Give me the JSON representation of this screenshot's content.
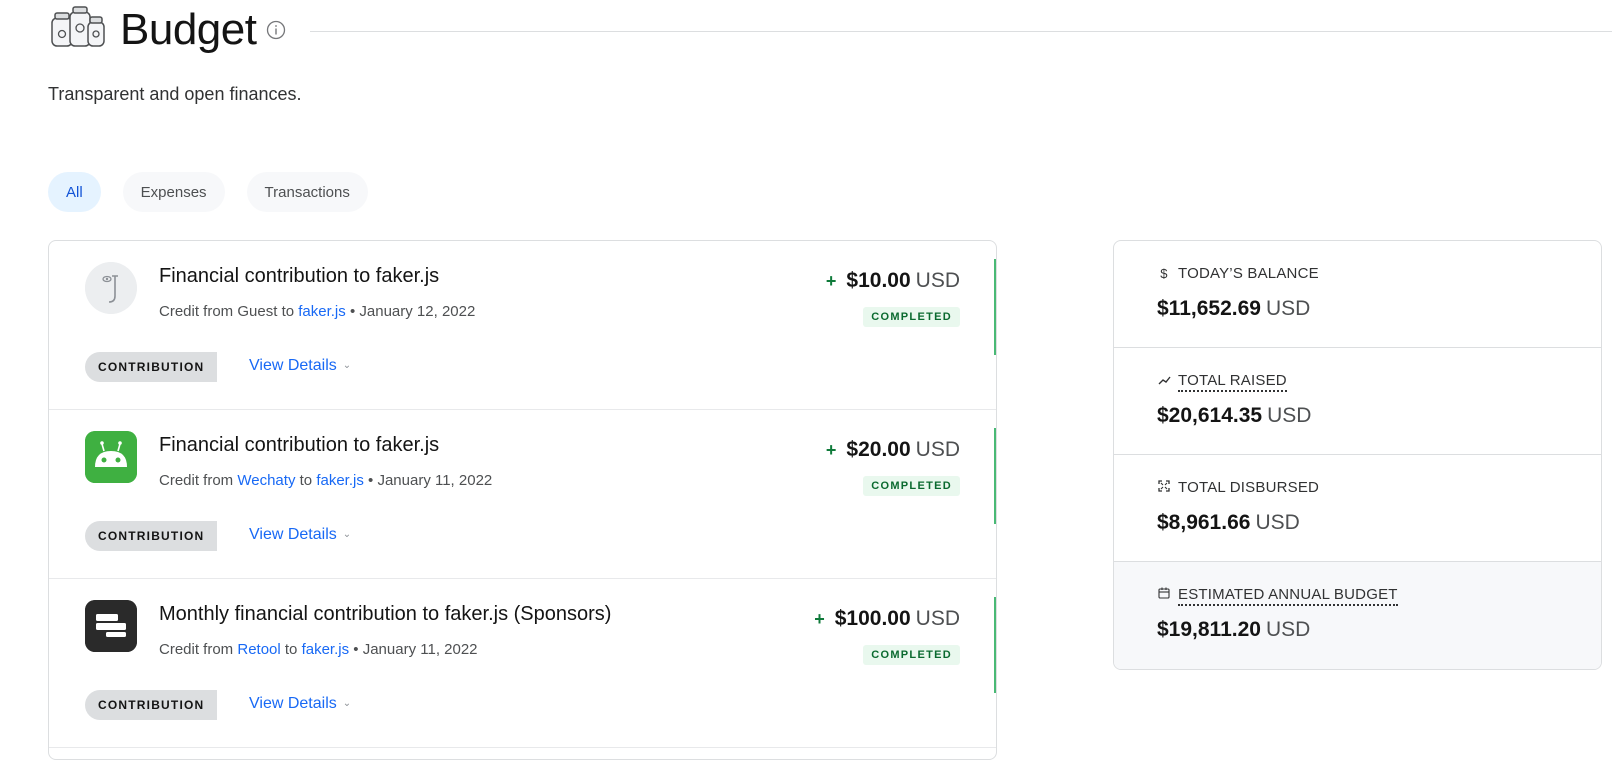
{
  "header": {
    "title": "Budget",
    "subtitle": "Transparent and open finances."
  },
  "tabs": [
    {
      "label": "All",
      "active": true
    },
    {
      "label": "Expenses",
      "active": false
    },
    {
      "label": "Transactions",
      "active": false
    }
  ],
  "transactions": [
    {
      "title": "Financial contribution to faker.js",
      "credit_prefix": "Credit from",
      "from": "Guest",
      "from_is_link": false,
      "to_word": "to",
      "to": "faker.js",
      "separator": "•",
      "date": "January 12, 2022",
      "plus": "+",
      "amount": "$10.00",
      "currency": "USD",
      "status": "COMPLETED",
      "tag": "CONTRIBUTION",
      "details_label": "View Details",
      "avatar": "guest-avatar-icon"
    },
    {
      "title": "Financial contribution to faker.js",
      "credit_prefix": "Credit from",
      "from": "Wechaty",
      "from_is_link": true,
      "to_word": "to",
      "to": "faker.js",
      "separator": "•",
      "date": "January 11, 2022",
      "plus": "+",
      "amount": "$20.00",
      "currency": "USD",
      "status": "COMPLETED",
      "tag": "CONTRIBUTION",
      "details_label": "View Details",
      "avatar": "wechaty-robot-icon"
    },
    {
      "title": "Monthly financial contribution to faker.js (Sponsors)",
      "credit_prefix": "Credit from",
      "from": "Retool",
      "from_is_link": true,
      "to_word": "to",
      "to": "faker.js",
      "separator": "•",
      "date": "January 11, 2022",
      "plus": "+",
      "amount": "$100.00",
      "currency": "USD",
      "status": "COMPLETED",
      "tag": "CONTRIBUTION",
      "details_label": "View Details",
      "avatar": "retool-logo-icon"
    }
  ],
  "summary": {
    "todays_balance": {
      "icon": "dollar-icon",
      "label": "TODAY’S BALANCE",
      "amount": "$11,652.69",
      "currency": "USD"
    },
    "total_raised": {
      "icon": "trend-up-icon",
      "label": "TOTAL RAISED",
      "amount": "$20,614.35",
      "currency": "USD"
    },
    "total_disbursed": {
      "icon": "expand-arrows-icon",
      "label": "TOTAL DISBURSED",
      "amount": "$8,961.66",
      "currency": "USD"
    },
    "estimated_annual_budget": {
      "icon": "calendar-icon",
      "label": "ESTIMATED ANNUAL BUDGET",
      "amount": "$19,811.20",
      "currency": "USD"
    }
  },
  "colors": {
    "link": "#1869f5",
    "active_tab_bg": "#e5f3ff",
    "status_green_bg": "#e9f8ee",
    "status_green_text": "#0a6a2f",
    "wechaty_green": "#3fb041",
    "retool_dark": "#2a2a2a"
  }
}
